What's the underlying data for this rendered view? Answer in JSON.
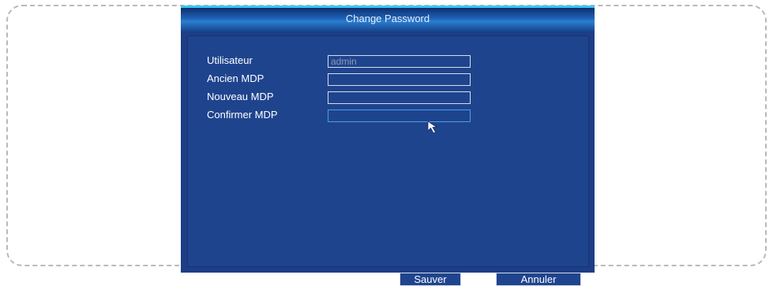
{
  "dialog": {
    "title": "Change Password"
  },
  "form": {
    "fields": [
      {
        "label": "Utilisateur",
        "value": "admin",
        "placeholder": ""
      },
      {
        "label": "Ancien MDP",
        "value": "",
        "placeholder": ""
      },
      {
        "label": "Nouveau MDP",
        "value": "",
        "placeholder": ""
      },
      {
        "label": "Confirmer MDP",
        "value": "",
        "placeholder": ""
      }
    ]
  },
  "buttons": {
    "save_label": "Sauver",
    "cancel_label": "Annuler"
  },
  "colors": {
    "background": "#1d3e87",
    "titlebar_accent": "#39c6f0",
    "focus_border": "#4a9ee0"
  },
  "icons": [
    "mouse-pointer-icon"
  ]
}
